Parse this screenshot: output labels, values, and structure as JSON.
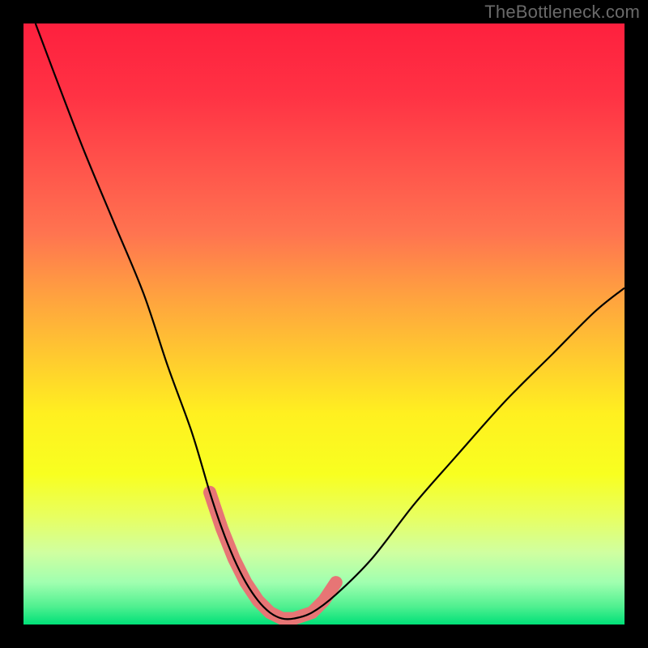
{
  "attribution": "TheBottleneck.com",
  "chart_data": {
    "type": "line",
    "title": "",
    "xlabel": "",
    "ylabel": "",
    "xlim": [
      0,
      100
    ],
    "ylim": [
      0,
      100
    ],
    "grid": false,
    "legend": false,
    "description": "V-shaped bottleneck curve over a vertical green→red gradient; minimum region (lowest bottleneck) highlighted with pink markers near the bottom.",
    "series": [
      {
        "name": "bottleneck-curve",
        "x": [
          2,
          5,
          10,
          15,
          20,
          24,
          28,
          31,
          33,
          35,
          37,
          39,
          41,
          43,
          45,
          48,
          52,
          58,
          65,
          72,
          80,
          88,
          95,
          100
        ],
        "y": [
          100,
          92,
          79,
          67,
          55,
          43,
          32,
          22,
          16,
          11,
          7,
          4,
          2,
          1,
          1,
          2,
          5,
          11,
          20,
          28,
          37,
          45,
          52,
          56
        ]
      }
    ],
    "highlight_region": {
      "name": "optimal-zone",
      "x": [
        31,
        33,
        35,
        37,
        39,
        41,
        43,
        45,
        48,
        50,
        52
      ],
      "y": [
        22,
        16,
        11,
        7,
        4,
        2,
        1,
        1,
        2,
        4,
        7
      ]
    },
    "background_gradient": {
      "stops": [
        {
          "pos": 0.0,
          "color": "#fe203e"
        },
        {
          "pos": 0.12,
          "color": "#ff3244"
        },
        {
          "pos": 0.25,
          "color": "#ff574c"
        },
        {
          "pos": 0.35,
          "color": "#ff7450"
        },
        {
          "pos": 0.45,
          "color": "#ffa040"
        },
        {
          "pos": 0.55,
          "color": "#ffc830"
        },
        {
          "pos": 0.65,
          "color": "#fff020"
        },
        {
          "pos": 0.75,
          "color": "#f8ff20"
        },
        {
          "pos": 0.82,
          "color": "#e8ff60"
        },
        {
          "pos": 0.88,
          "color": "#d0ffa0"
        },
        {
          "pos": 0.93,
          "color": "#a0ffb0"
        },
        {
          "pos": 0.97,
          "color": "#50f090"
        },
        {
          "pos": 1.0,
          "color": "#00e078"
        }
      ]
    }
  }
}
